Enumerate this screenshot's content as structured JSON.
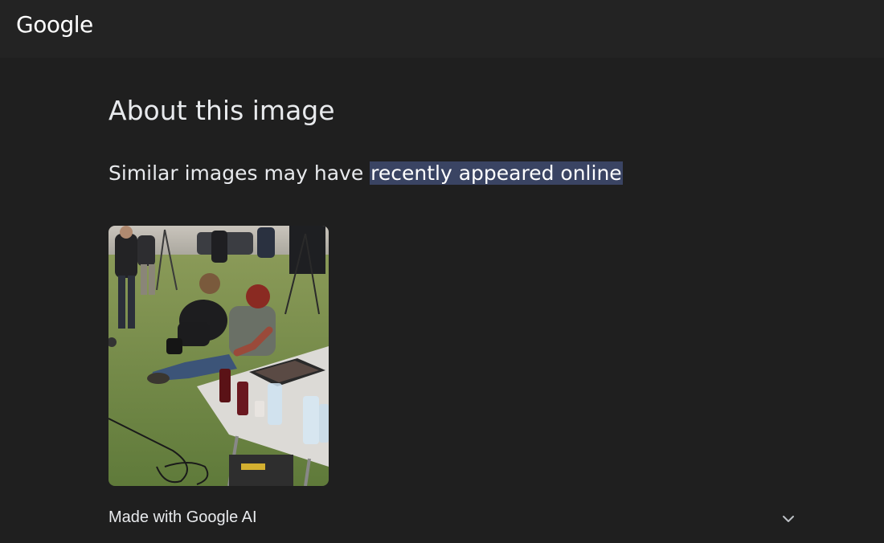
{
  "header": {
    "logo_text": "Google"
  },
  "main": {
    "title": "About this image",
    "subtitle_prefix": "Similar images may have ",
    "subtitle_highlight": "recently appeared online",
    "image": {
      "icon": "photo-thumbnail"
    },
    "made_with": {
      "label": "Made with Google AI",
      "icon": "chevron-down-icon"
    }
  },
  "colors": {
    "background": "#1f1f1f",
    "topbar": "#232323",
    "highlight_bg": "#3a4463",
    "text": "#e8eaed"
  }
}
